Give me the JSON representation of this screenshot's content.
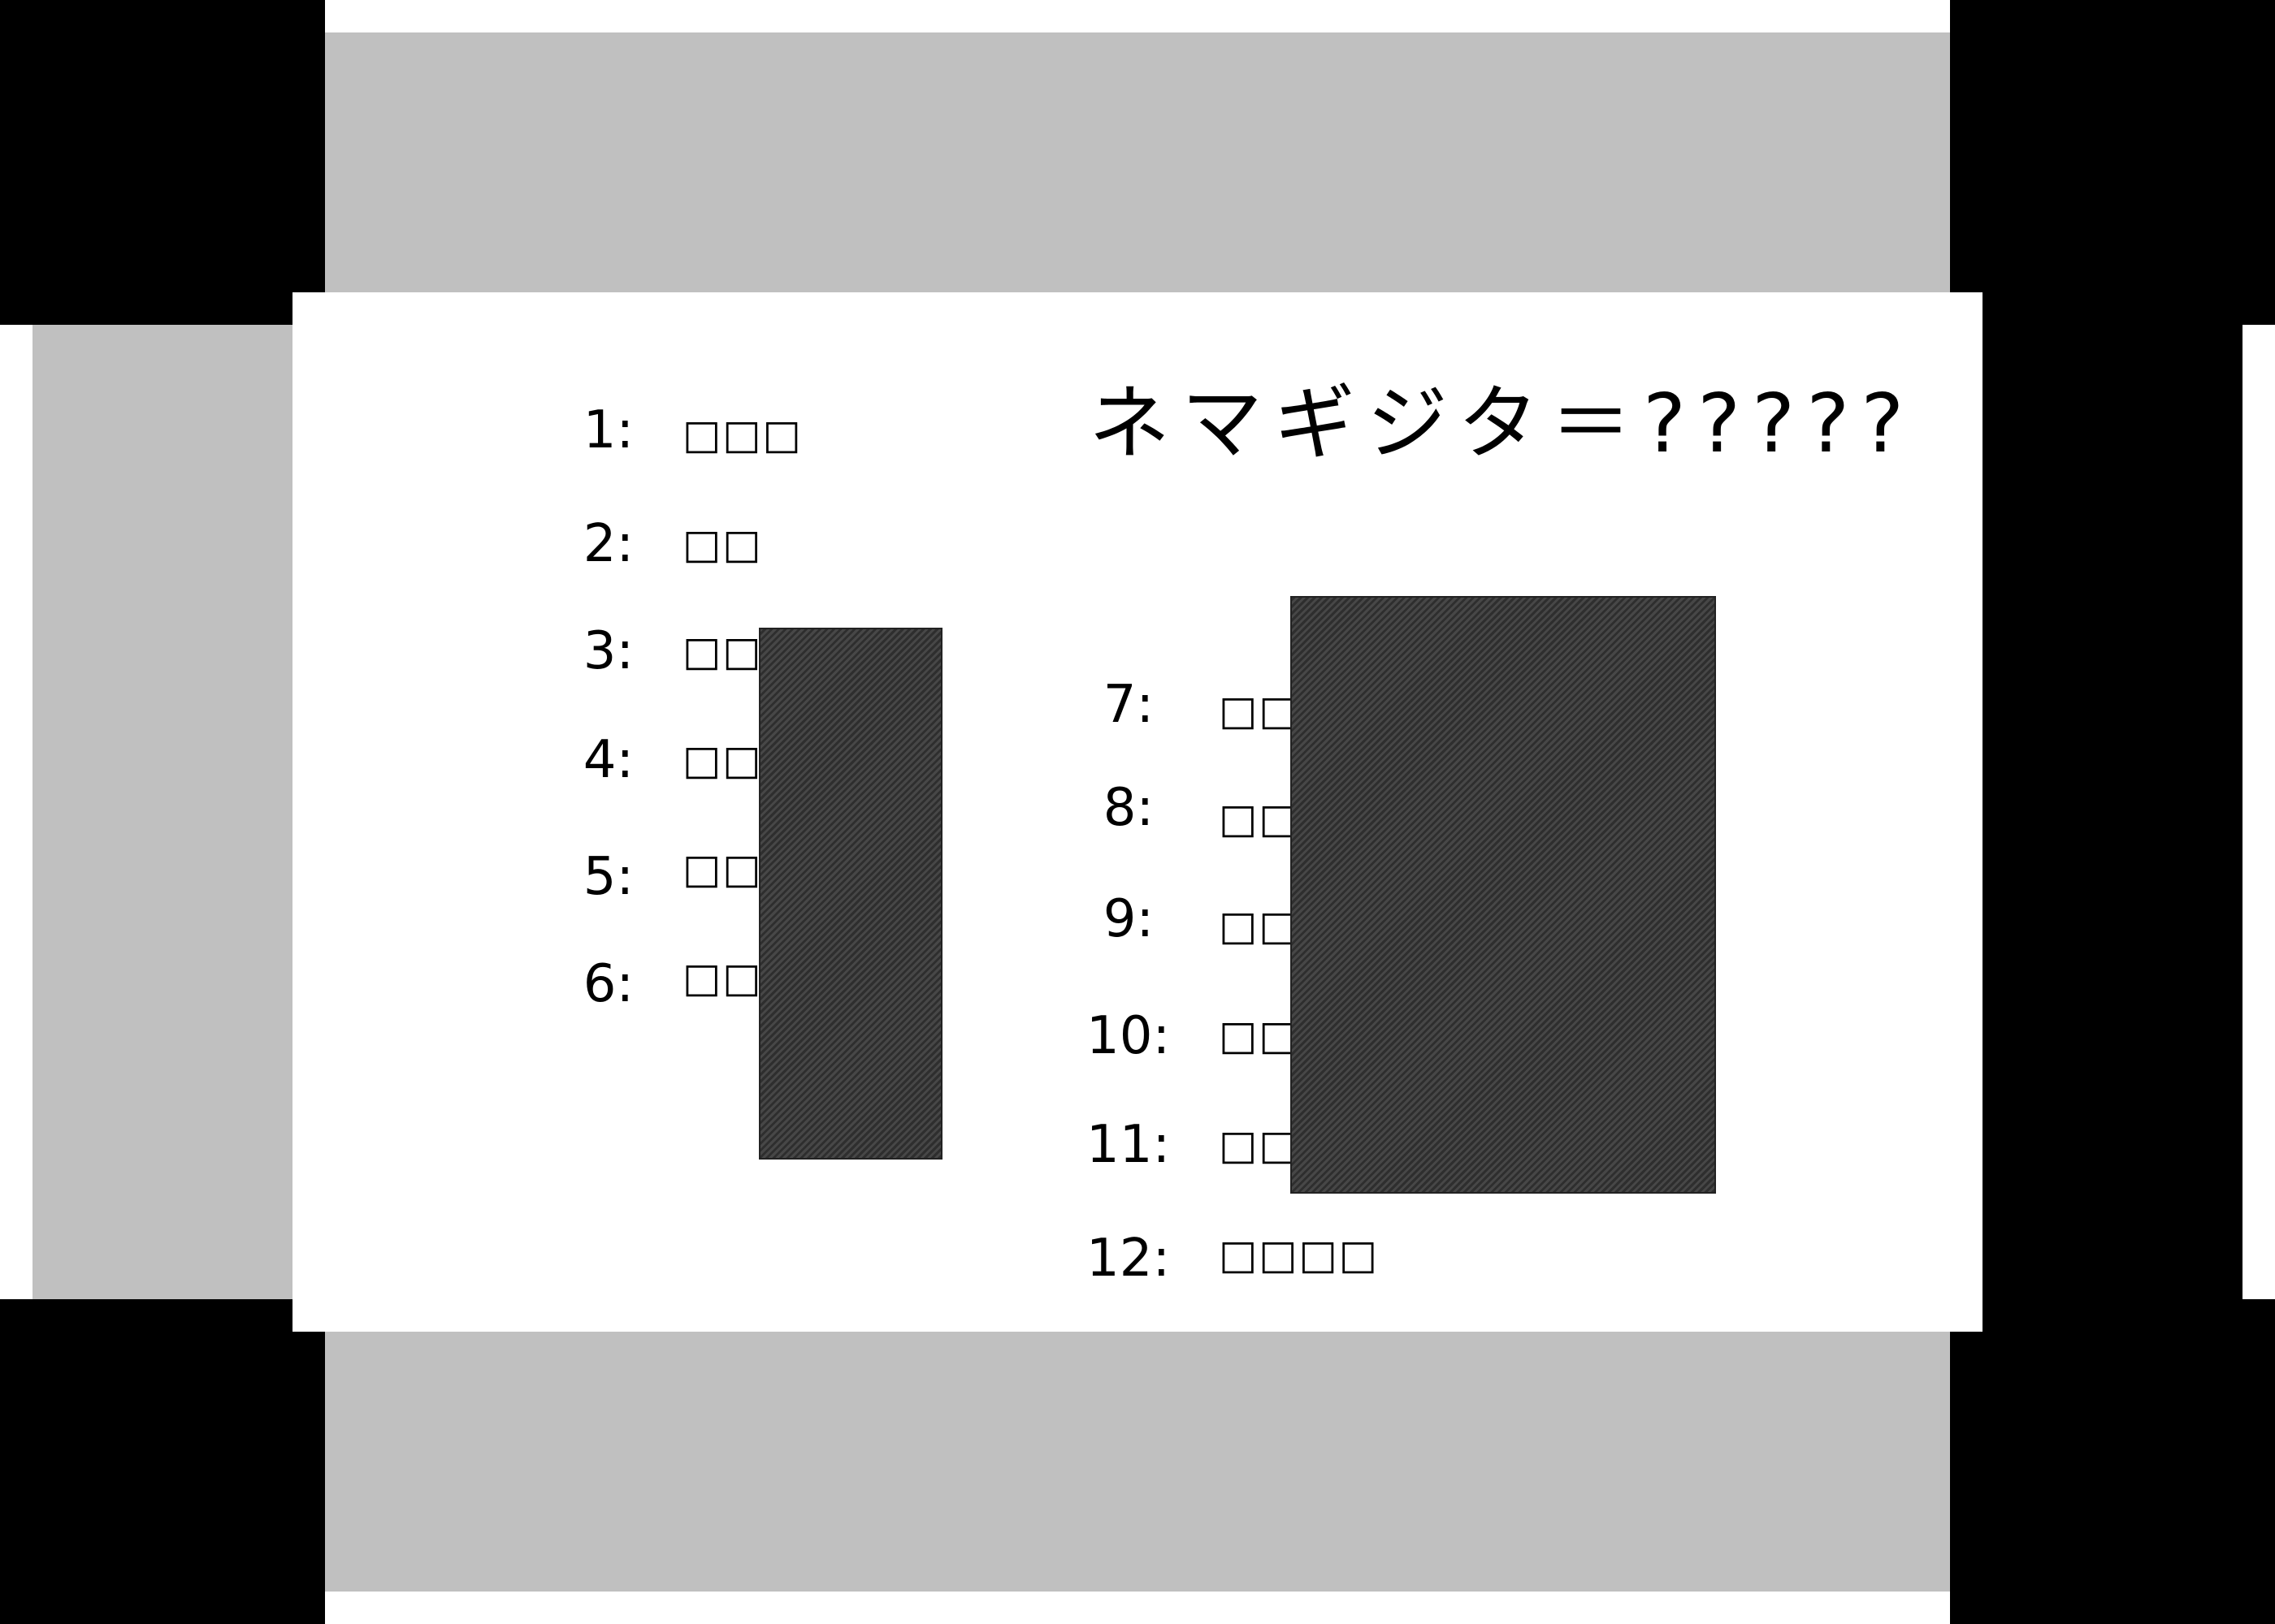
{
  "title": "ネマギジタ＝?????",
  "items": [
    {
      "number": "1:",
      "glyphs": "□□□"
    },
    {
      "number": "2:",
      "glyphs": "□□"
    },
    {
      "number": "3:",
      "glyphs": "□□"
    },
    {
      "number": "4:",
      "glyphs": "□□"
    },
    {
      "number": "5:",
      "glyphs": "□□"
    },
    {
      "number": "6:",
      "glyphs": "□□"
    },
    {
      "number": "7:",
      "glyphs": "□□"
    },
    {
      "number": "8:",
      "glyphs": "□□"
    },
    {
      "number": "9:",
      "glyphs": "□□"
    },
    {
      "number": "10:",
      "glyphs": "□□"
    },
    {
      "number": "11:",
      "glyphs": "□□"
    },
    {
      "number": "12:",
      "glyphs": "□□□□"
    }
  ],
  "colors": {
    "frame_black": "#000000",
    "frame_gray": "#c0c0c0",
    "panel": "#ffffff",
    "hatch": "#3a3a3a"
  }
}
